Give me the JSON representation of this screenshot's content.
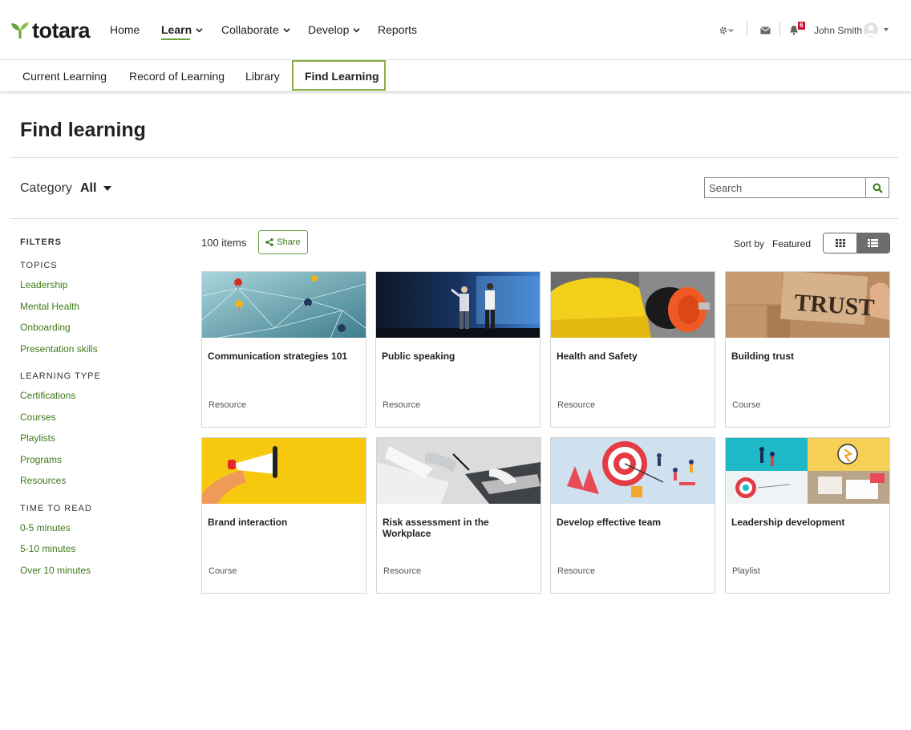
{
  "header": {
    "logo_text": "totara",
    "nav": [
      {
        "label": "Home"
      },
      {
        "label": "Learn"
      },
      {
        "label": "Collaborate"
      },
      {
        "label": "Develop"
      },
      {
        "label": "Reports"
      }
    ],
    "notification_count": "6",
    "user_name": "John Smith"
  },
  "subnav": {
    "items": [
      {
        "label": "Current Learning"
      },
      {
        "label": "Record of Learning"
      },
      {
        "label": "Library"
      },
      {
        "label": "Find Learning"
      }
    ]
  },
  "page": {
    "title": "Find learning",
    "category_label": "Category",
    "category_value": "All",
    "search_placeholder": "Search"
  },
  "filters": {
    "title": "FILTERS",
    "groups": [
      {
        "title": "TOPICS",
        "items": [
          "Leadership",
          "Mental Health",
          "Onboarding",
          "Presentation skills"
        ]
      },
      {
        "title": "LEARNING TYPE",
        "items": [
          "Certifications",
          "Courses",
          "Playlists",
          "Programs",
          "Resources"
        ]
      },
      {
        "title": "TIME TO READ",
        "items": [
          "0-5 minutes",
          "5-10 minutes",
          "Over 10 minutes"
        ]
      }
    ]
  },
  "results": {
    "count": "100 items",
    "share_label": "Share",
    "sort_label": "Sort by",
    "sort_value": "Featured"
  },
  "cards": [
    {
      "title": "Communication strategies 101",
      "type": "Resource"
    },
    {
      "title": "Public speaking",
      "type": "Resource"
    },
    {
      "title": "Health and Safety",
      "type": "Resource"
    },
    {
      "title": "Building trust",
      "type": "Course",
      "image_text": "TRUST"
    },
    {
      "title": "Brand interaction",
      "type": "Course"
    },
    {
      "title": "Risk assessment in the Workplace",
      "type": "Resource"
    },
    {
      "title": "Develop effective team",
      "type": "Resource"
    },
    {
      "title": "Leadership development",
      "type": "Playlist"
    }
  ],
  "colors": {
    "brand_green": "#69a33b",
    "link_green": "#3e7a17",
    "badge_red": "#c8102e"
  }
}
